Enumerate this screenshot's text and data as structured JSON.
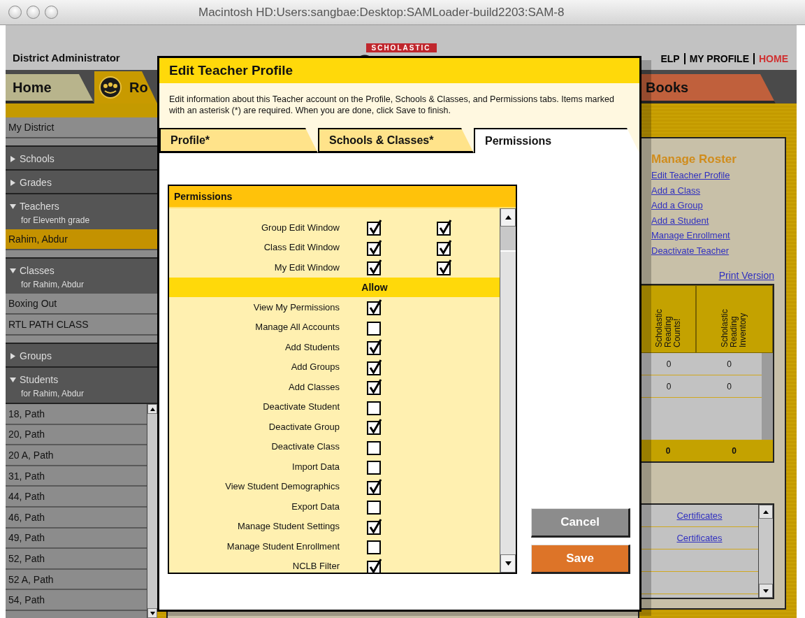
{
  "window": {
    "title": "Macintosh HD:Users:sangbae:Desktop:SAMLoader-build2203:SAM-8"
  },
  "header": {
    "role": "District Administrator",
    "brand": "SCHOLASTIC",
    "links": [
      {
        "label": "ELP",
        "color": "#000000"
      },
      {
        "label": "MY PROFILE",
        "color": "#000000"
      },
      {
        "label": "HOME",
        "color": "#d03030"
      }
    ]
  },
  "nav_tabs": [
    {
      "label": "Home",
      "selected": false,
      "color": "#b8b48c"
    },
    {
      "label": "Ro",
      "selected": true,
      "color": "#c89a00"
    },
    {
      "label": "Books",
      "selected": false,
      "color": "#c0603c"
    }
  ],
  "sidebar": {
    "items": [
      {
        "kind": "item",
        "label": "My District",
        "selected": false
      },
      {
        "kind": "section",
        "label": "Schools",
        "expanded": false
      },
      {
        "kind": "section",
        "label": "Grades",
        "expanded": false
      },
      {
        "kind": "section",
        "label": "Teachers",
        "expanded": true,
        "subtitle": "for Eleventh grade"
      },
      {
        "kind": "item",
        "label": "Rahim, Abdur",
        "selected": true
      },
      {
        "kind": "section",
        "label": "Classes",
        "expanded": true,
        "subtitle": "for Rahim, Abdur"
      },
      {
        "kind": "item",
        "label": "Boxing Out",
        "selected": false
      },
      {
        "kind": "item",
        "label": "RTL PATH CLASS",
        "selected": false
      },
      {
        "kind": "section",
        "label": "Groups",
        "expanded": false
      },
      {
        "kind": "section",
        "label": "Students",
        "expanded": true,
        "subtitle": "for Rahim, Abdur"
      }
    ],
    "students": [
      "18, Path",
      "20, Path",
      "20 A, Path",
      "31, Path",
      "44, Path",
      "46, Path",
      "49, Path",
      "52, Path",
      "52 A, Path",
      "54, Path"
    ]
  },
  "roster_panel": {
    "title": "Manage Roster",
    "links": [
      "Edit Teacher Profile",
      "Add a Class",
      "Add a Group",
      "Add a Student",
      "Manage Enrollment",
      "Deactivate Teacher"
    ],
    "print_link": "Print Version",
    "table": {
      "columns": [
        "Scholastic Reading Counts!",
        "Scholastic Reading Inventory"
      ],
      "rows": [
        [
          "0",
          "0"
        ],
        [
          "0",
          "0"
        ]
      ],
      "totals": [
        "0",
        "0"
      ]
    },
    "certificates": [
      "Certificates",
      "Certificates"
    ]
  },
  "modal": {
    "title": "Edit Teacher Profile",
    "description": "Edit information about this Teacher account on the Profile, Schools & Classes, and Permissions tabs. Items marked with an asterisk (*) are required. When you are done, click Save to finish.",
    "tabs": [
      {
        "label": "Profile*",
        "selected": false
      },
      {
        "label": "Schools & Classes*",
        "selected": false
      },
      {
        "label": "Permissions",
        "selected": true
      }
    ],
    "permissions": {
      "title": "Permissions",
      "rows": [
        {
          "kind": "row",
          "label": "Group Edit Window",
          "checks": [
            true,
            true
          ]
        },
        {
          "kind": "row",
          "label": "Class Edit Window",
          "checks": [
            true,
            true
          ]
        },
        {
          "kind": "row",
          "label": "My Edit Window",
          "checks": [
            true,
            true
          ]
        },
        {
          "kind": "section",
          "label": "Allow"
        },
        {
          "kind": "row",
          "label": "View My Permissions",
          "checks": [
            true
          ]
        },
        {
          "kind": "row",
          "label": "Manage All Accounts",
          "checks": [
            false
          ]
        },
        {
          "kind": "row",
          "label": "Add Students",
          "checks": [
            true
          ]
        },
        {
          "kind": "row",
          "label": "Add Groups",
          "checks": [
            true
          ]
        },
        {
          "kind": "row",
          "label": "Add Classes",
          "checks": [
            true
          ]
        },
        {
          "kind": "row",
          "label": "Deactivate Student",
          "checks": [
            false
          ]
        },
        {
          "kind": "row",
          "label": "Deactivate Group",
          "checks": [
            true
          ]
        },
        {
          "kind": "row",
          "label": "Deactivate Class",
          "checks": [
            false
          ]
        },
        {
          "kind": "row",
          "label": "Import Data",
          "checks": [
            false
          ]
        },
        {
          "kind": "row",
          "label": "View Student Demographics",
          "checks": [
            true
          ]
        },
        {
          "kind": "row",
          "label": "Export Data",
          "checks": [
            false
          ]
        },
        {
          "kind": "row",
          "label": "Manage Student Settings",
          "checks": [
            true
          ]
        },
        {
          "kind": "row",
          "label": "Manage Student Enrollment",
          "checks": [
            false
          ]
        },
        {
          "kind": "row",
          "label": "NCLB Filter",
          "checks": [
            true
          ]
        }
      ]
    },
    "buttons": [
      {
        "label": "Cancel",
        "kind": "cancel"
      },
      {
        "label": "Save",
        "kind": "save"
      }
    ]
  }
}
